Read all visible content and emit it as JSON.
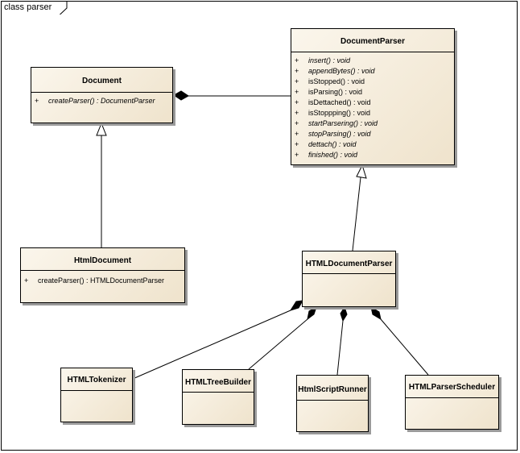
{
  "frame": {
    "label": "class parser"
  },
  "classes": {
    "document": {
      "name": "Document",
      "operations": [
        {
          "visibility": "+",
          "signature": "createParser() : DocumentParser",
          "italic": true
        }
      ]
    },
    "document_parser": {
      "name": "DocumentParser",
      "operations": [
        {
          "visibility": "+",
          "signature": "insert() : void",
          "italic": true
        },
        {
          "visibility": "+",
          "signature": "appendBytes() : void",
          "italic": true
        },
        {
          "visibility": "+",
          "signature": "isStopped() : void",
          "italic": false
        },
        {
          "visibility": "+",
          "signature": "isParsing() : void",
          "italic": false
        },
        {
          "visibility": "+",
          "signature": "isDettached() : void",
          "italic": false
        },
        {
          "visibility": "+",
          "signature": "isStoppping() : void",
          "italic": false
        },
        {
          "visibility": "+",
          "signature": "startParsering() : void",
          "italic": true
        },
        {
          "visibility": "+",
          "signature": "stopParsing() : void",
          "italic": true
        },
        {
          "visibility": "+",
          "signature": "dettach() : void",
          "italic": true
        },
        {
          "visibility": "+",
          "signature": "finished() : void",
          "italic": true
        }
      ]
    },
    "html_document": {
      "name": "HtmlDocument",
      "operations": [
        {
          "visibility": "+",
          "signature": "createParser() : HTMLDocumentParser",
          "italic": false
        }
      ]
    },
    "html_document_parser": {
      "name": "HTMLDocumentParser",
      "operations": []
    },
    "html_tokenizer": {
      "name": "HTMLTokenizer"
    },
    "html_tree_builder": {
      "name": "HTMLTreeBuilder"
    },
    "html_script_runner": {
      "name": "HtmlScriptRunner"
    },
    "html_parser_scheduler": {
      "name": "HTMLParserScheduler"
    }
  },
  "relationships": [
    {
      "type": "composition",
      "whole": "Document",
      "part": "DocumentParser"
    },
    {
      "type": "generalization",
      "child": "HtmlDocument",
      "parent": "Document"
    },
    {
      "type": "generalization",
      "child": "HTMLDocumentParser",
      "parent": "DocumentParser"
    },
    {
      "type": "composition",
      "whole": "HTMLDocumentParser",
      "part": "HTMLTokenizer"
    },
    {
      "type": "composition",
      "whole": "HTMLDocumentParser",
      "part": "HTMLTreeBuilder"
    },
    {
      "type": "composition",
      "whole": "HTMLDocumentParser",
      "part": "HtmlScriptRunner"
    },
    {
      "type": "composition",
      "whole": "HTMLDocumentParser",
      "part": "HTMLParserScheduler"
    }
  ]
}
